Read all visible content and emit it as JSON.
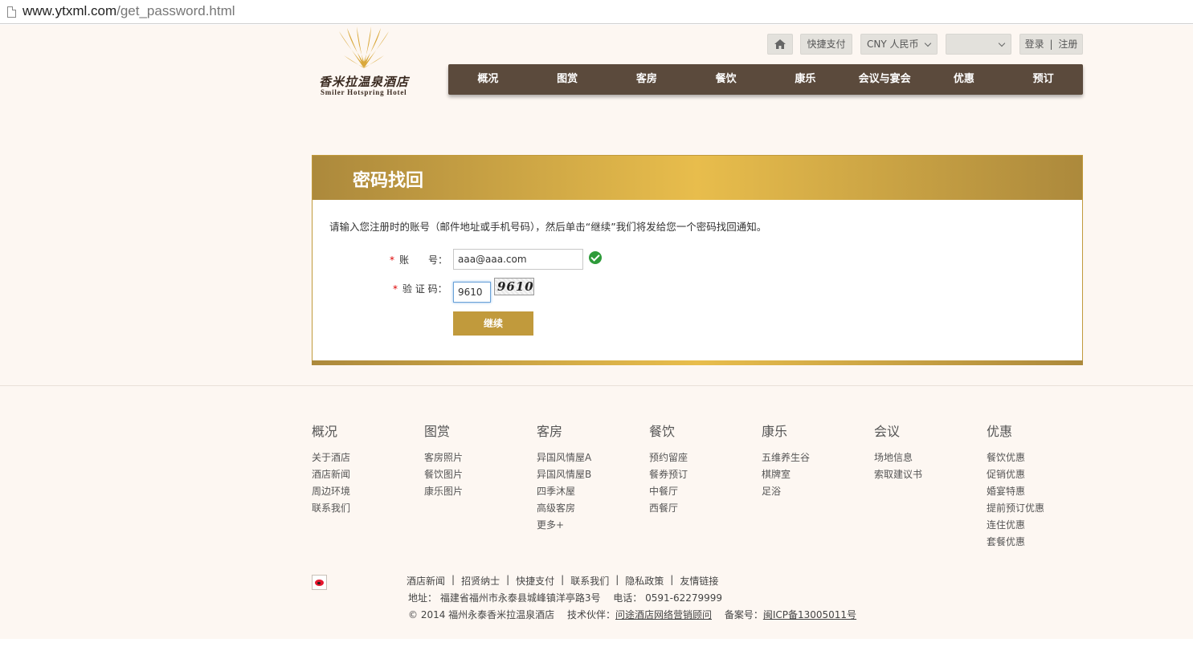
{
  "browser": {
    "url_host": "www.ytxml.com",
    "url_path": "/get_password.html"
  },
  "logo": {
    "cn": "香米拉温泉酒店",
    "en": "Smiler Hotspring Hotel"
  },
  "util": {
    "pay": "快捷支付",
    "currency": "CNY 人民币",
    "language": "",
    "login": "登录",
    "register": "注册",
    "login_sep": "|"
  },
  "nav": [
    "概况",
    "图赏",
    "客房",
    "餐饮",
    "康乐",
    "会议与宴会",
    "优惠",
    "预订"
  ],
  "panel": {
    "title": "密码找回",
    "intro": "请输入您注册时的账号（邮件地址或手机号码），然后单击“继续”我们将发给您一个密码找回通知。",
    "account_label": "账　　号：",
    "account_value": "aaa@aaa.com",
    "captcha_label": "验 证 码：",
    "captcha_value": "9610",
    "captcha_image_text": "9610",
    "required_mark": "*",
    "continue": "继续"
  },
  "footer": {
    "columns": [
      {
        "title": "概况",
        "links": [
          "关于酒店",
          "酒店新闻",
          "周边环境",
          "联系我们"
        ]
      },
      {
        "title": "图赏",
        "links": [
          "客房照片",
          "餐饮图片",
          "康乐图片"
        ]
      },
      {
        "title": "客房",
        "links": [
          "异国风情屋A",
          "异国风情屋B",
          "四季沐屋",
          "高级客房",
          "更多+"
        ]
      },
      {
        "title": "餐饮",
        "links": [
          "预约留座",
          "餐券预订",
          "中餐厅",
          "西餐厅"
        ]
      },
      {
        "title": "康乐",
        "links": [
          "五维养生谷",
          "棋牌室",
          "足浴"
        ]
      },
      {
        "title": "会议",
        "links": [
          "场地信息",
          "索取建议书"
        ]
      },
      {
        "title": "优惠",
        "links": [
          "餐饮优惠",
          "促销优惠",
          "婚宴特惠",
          "提前预订优惠",
          "连住优惠",
          "套餐优惠"
        ]
      }
    ],
    "links": [
      "酒店新闻",
      "招贤纳士",
      "快捷支付",
      "联系我们",
      "隐私政策",
      "友情链接"
    ],
    "address": "地址： 福建省福州市永泰县城峰镇洋亭路3号　 电话： 0591-62279999",
    "copyright": "© 2014 福州永泰香米拉温泉酒店　 技术伙伴：",
    "partner": "问途酒店网络营销顾问",
    "icp_label": "　 备案号：",
    "icp": "闽ICP备13005011号"
  }
}
